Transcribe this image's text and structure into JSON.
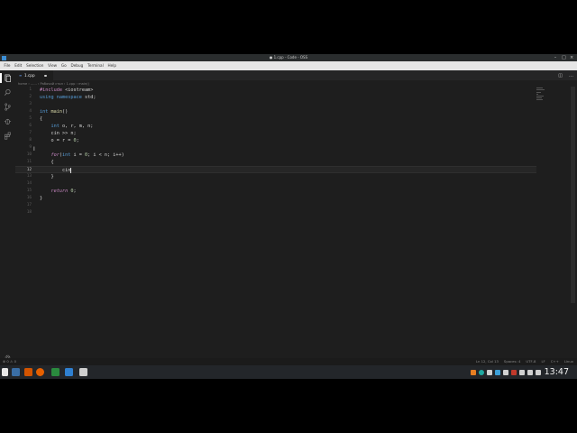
{
  "window": {
    "title": "● 1.cpp - Code - OSS"
  },
  "menu": [
    "File",
    "Edit",
    "Selection",
    "View",
    "Go",
    "Debug",
    "Terminal",
    "Help"
  ],
  "tab": {
    "label": "1.cpp",
    "file_icon": "C++"
  },
  "breadcrumb": "home › ...... › Рабочий стол › 1.cpp › main()",
  "editor": {
    "lines": [
      {
        "n": "1",
        "tokens": [
          {
            "t": "#include",
            "c": "pp"
          },
          {
            "t": " <iostream>",
            "c": ""
          }
        ]
      },
      {
        "n": "2",
        "tokens": [
          {
            "t": "using",
            "c": "kw"
          },
          {
            "t": " ",
            "c": ""
          },
          {
            "t": "namespace",
            "c": "kw"
          },
          {
            "t": " std;",
            "c": ""
          }
        ]
      },
      {
        "n": "3",
        "tokens": []
      },
      {
        "n": "4",
        "tokens": [
          {
            "t": "int",
            "c": "kw"
          },
          {
            "t": " ",
            "c": ""
          },
          {
            "t": "main",
            "c": "fn"
          },
          {
            "t": "()",
            "c": ""
          }
        ]
      },
      {
        "n": "5",
        "tokens": [
          {
            "t": "{",
            "c": ""
          }
        ]
      },
      {
        "n": "6",
        "tokens": [
          {
            "t": "    ",
            "c": ""
          },
          {
            "t": "int",
            "c": "kw"
          },
          {
            "t": " o, r, m, n;",
            "c": ""
          }
        ]
      },
      {
        "n": "7",
        "tokens": [
          {
            "t": "    cin >> n;",
            "c": ""
          }
        ]
      },
      {
        "n": "8",
        "tokens": [
          {
            "t": "    o = r = ",
            "c": ""
          },
          {
            "t": "0",
            "c": "num"
          },
          {
            "t": ";",
            "c": ""
          }
        ]
      },
      {
        "n": "9",
        "tokens": []
      },
      {
        "n": "10",
        "tokens": [
          {
            "t": "    ",
            "c": ""
          },
          {
            "t": "for",
            "c": "ctl"
          },
          {
            "t": "(",
            "c": ""
          },
          {
            "t": "int",
            "c": "kw"
          },
          {
            "t": " i = ",
            "c": ""
          },
          {
            "t": "0",
            "c": "num"
          },
          {
            "t": "; i < n; i++)",
            "c": ""
          }
        ]
      },
      {
        "n": "11",
        "tokens": [
          {
            "t": "    {",
            "c": ""
          }
        ]
      },
      {
        "n": "12",
        "tokens": [
          {
            "t": "        cin",
            "c": ""
          }
        ],
        "current": true
      },
      {
        "n": "13",
        "tokens": [
          {
            "t": "    }",
            "c": ""
          }
        ]
      },
      {
        "n": "14",
        "tokens": []
      },
      {
        "n": "15",
        "tokens": [
          {
            "t": "    ",
            "c": ""
          },
          {
            "t": "return",
            "c": "ctl"
          },
          {
            "t": " ",
            "c": ""
          },
          {
            "t": "0",
            "c": "num"
          },
          {
            "t": ";",
            "c": ""
          }
        ]
      },
      {
        "n": "16",
        "tokens": [
          {
            "t": "}",
            "c": ""
          }
        ]
      },
      {
        "n": "17",
        "tokens": []
      },
      {
        "n": "18",
        "tokens": []
      }
    ]
  },
  "status": {
    "left": "⊗ 0 ⚠ 0",
    "right": [
      "Ln 12, Col 13",
      "Spaces: 4",
      "UTF-8",
      "LF",
      "C++",
      "Linux"
    ]
  },
  "clock": "13:47",
  "icons": {
    "activity": [
      "files-icon",
      "search-icon",
      "source-control-icon",
      "debug-icon",
      "extensions-icon"
    ]
  }
}
